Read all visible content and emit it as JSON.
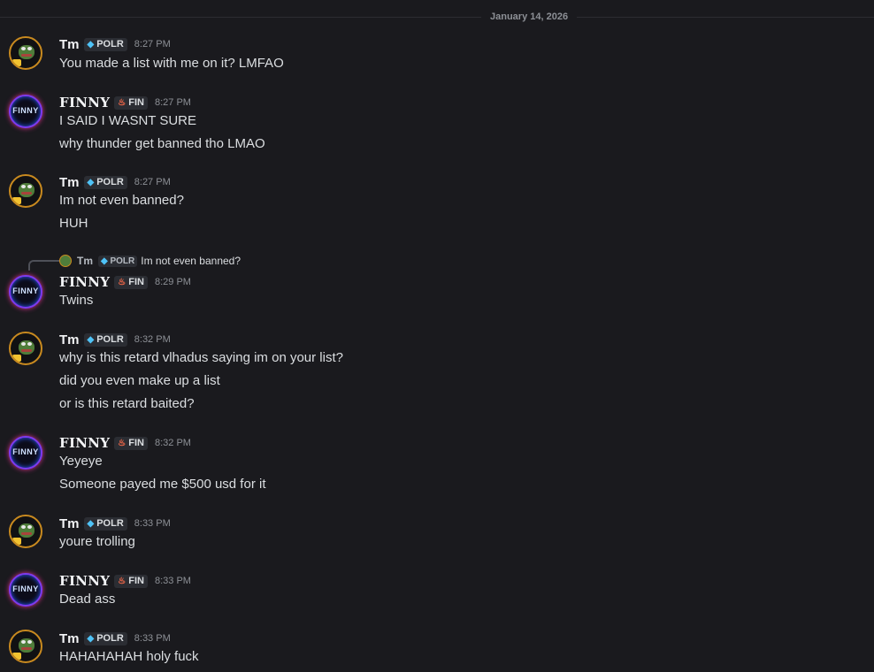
{
  "divider_date": "January 14, 2026",
  "users": {
    "tm": {
      "name": "Tm",
      "tag": "POLR",
      "tag_icon": "gem-icon"
    },
    "finny": {
      "name": "FINNY",
      "tag": "FIN",
      "tag_icon": "flame-icon",
      "avatar_text": "FINNY"
    }
  },
  "reply_preview": {
    "name": "Tm",
    "tag": "POLR",
    "text": "Im not even banned?"
  },
  "messages": [
    {
      "author": "Tm",
      "tag": "POLR",
      "time": "8:27 PM",
      "lines": [
        "You made a list with me on it? LMFAO"
      ]
    },
    {
      "author": "FINNY",
      "tag": "FIN",
      "time": "8:27 PM",
      "lines": [
        "I SAID I WASNT SURE",
        "why thunder get banned tho LMAO"
      ]
    },
    {
      "author": "Tm",
      "tag": "POLR",
      "time": "8:27 PM",
      "lines": [
        "Im not even banned?",
        "HUH"
      ]
    },
    {
      "author": "FINNY",
      "tag": "FIN",
      "time": "8:29 PM",
      "lines": [
        "Twins"
      ]
    },
    {
      "author": "Tm",
      "tag": "POLR",
      "time": "8:32 PM",
      "lines": [
        "why is this retard vlhadus saying im on your list?",
        "did you even make up a list",
        "or is this retard baited?"
      ]
    },
    {
      "author": "FINNY",
      "tag": "FIN",
      "time": "8:32 PM",
      "lines": [
        "Yeyeye",
        "Someone payed me $500 usd for it"
      ]
    },
    {
      "author": "Tm",
      "tag": "POLR",
      "time": "8:33 PM",
      "lines": [
        "youre trolling"
      ]
    },
    {
      "author": "FINNY",
      "tag": "FIN",
      "time": "8:33 PM",
      "lines": [
        "Dead ass"
      ]
    },
    {
      "author": "Tm",
      "tag": "POLR",
      "time": "8:33 PM",
      "lines": [
        "HAHAHAHAH holy fuck"
      ]
    }
  ],
  "colors": {
    "background": "#1a1a1e",
    "text": "#dbdee1",
    "muted": "#8d9096",
    "tm_ring": "#c98a1f",
    "finny_ring": "#7b3cf0"
  }
}
